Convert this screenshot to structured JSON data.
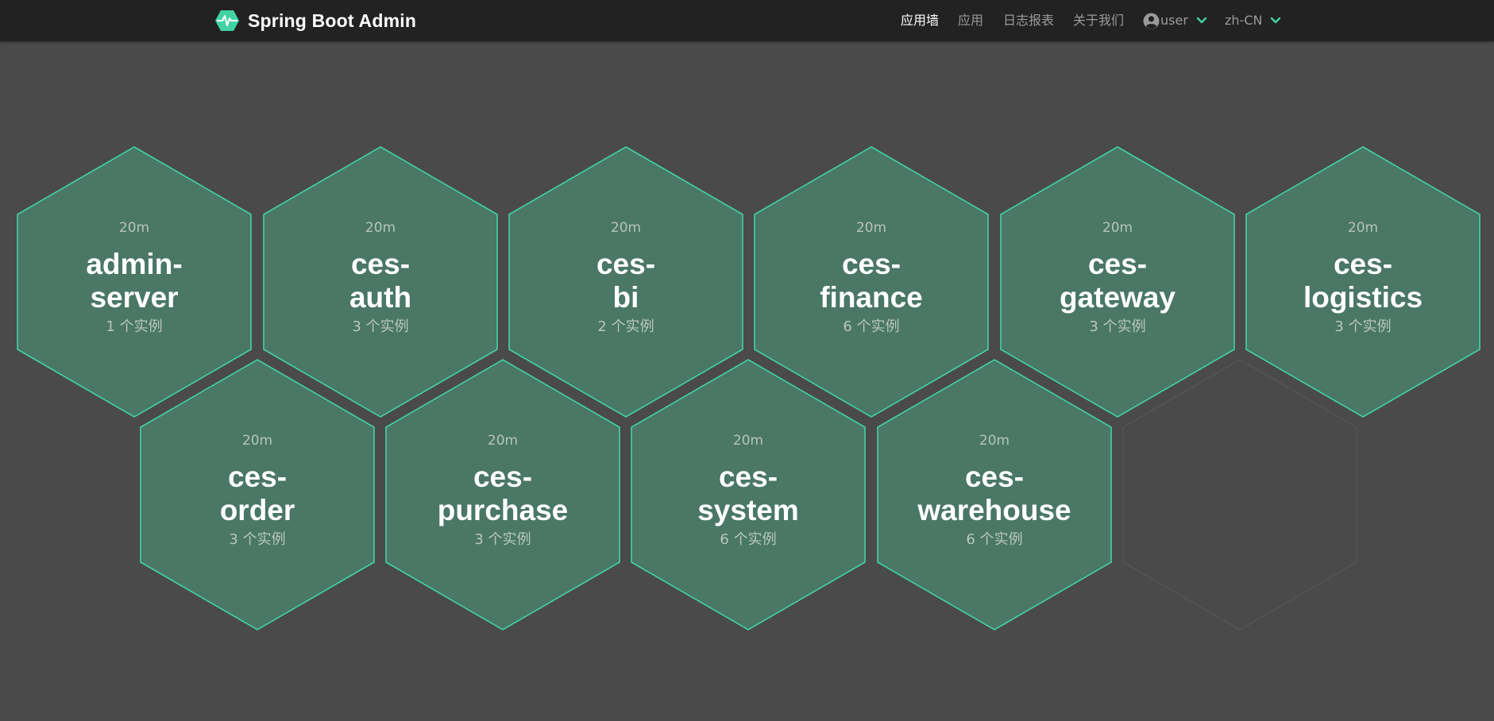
{
  "app": {
    "brand_name": "Spring Boot Admin",
    "logo_icon": "heartbeat-hexagon-icon"
  },
  "nav": {
    "wallboard_label": "应用墙",
    "applications_label": "应用",
    "journal_label": "日志报表",
    "about_label": "关于我们",
    "user_label": "user",
    "language_label": "zh-CN"
  },
  "colors": {
    "navbar_bg": "#222222",
    "page_bg": "#4a4a4a",
    "hex_fill": "#4a7766",
    "hex_stroke": "#42d3a5",
    "empty_hex_stroke": "#565656",
    "accent": "#42d3a5"
  },
  "applications": [
    {
      "name": "admin-server",
      "name_line1": "admin-",
      "name_line2": "server",
      "time": "20m",
      "instances": "1 个实例",
      "status": "UP"
    },
    {
      "name": "ces-auth",
      "name_line1": "ces-",
      "name_line2": "auth",
      "time": "20m",
      "instances": "3 个实例",
      "status": "UP"
    },
    {
      "name": "ces-bi",
      "name_line1": "ces-",
      "name_line2": "bi",
      "time": "20m",
      "instances": "2 个实例",
      "status": "UP"
    },
    {
      "name": "ces-finance",
      "name_line1": "ces-",
      "name_line2": "finance",
      "time": "20m",
      "instances": "6 个实例",
      "status": "UP"
    },
    {
      "name": "ces-gateway",
      "name_line1": "ces-",
      "name_line2": "gateway",
      "time": "20m",
      "instances": "3 个实例",
      "status": "UP"
    },
    {
      "name": "ces-logistics",
      "name_line1": "ces-",
      "name_line2": "logistics",
      "time": "20m",
      "instances": "3 个实例",
      "status": "UP"
    },
    {
      "name": "ces-order",
      "name_line1": "ces-",
      "name_line2": "order",
      "time": "20m",
      "instances": "3 个实例",
      "status": "UP"
    },
    {
      "name": "ces-purchase",
      "name_line1": "ces-",
      "name_line2": "purchase",
      "time": "20m",
      "instances": "3 个实例",
      "status": "UP"
    },
    {
      "name": "ces-system",
      "name_line1": "ces-",
      "name_line2": "system",
      "time": "20m",
      "instances": "6 个实例",
      "status": "UP"
    },
    {
      "name": "ces-warehouse",
      "name_line1": "ces-",
      "name_line2": "warehouse",
      "time": "20m",
      "instances": "6 个实例",
      "status": "UP"
    }
  ]
}
